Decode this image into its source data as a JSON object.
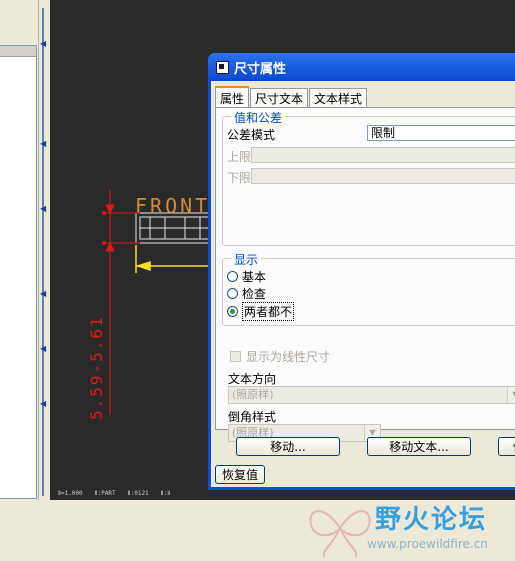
{
  "dialog": {
    "title": "尺寸属性",
    "tabs": [
      {
        "label": "属性",
        "active": true
      },
      {
        "label": "尺寸文本",
        "active": false
      },
      {
        "label": "文本样式",
        "active": false
      }
    ],
    "value_tolerance": {
      "title": "值和公差",
      "tolerance_mode_label": "公差模式",
      "tolerance_mode_value": "限制",
      "upper_label": "上限",
      "lower_label": "下限"
    },
    "display": {
      "title": "显示",
      "options": [
        {
          "label": "基本",
          "checked": false
        },
        {
          "label": "检查",
          "checked": false
        },
        {
          "label": "两者都不",
          "checked": true
        }
      ]
    },
    "linear_checkbox_label": "显示为线性尺寸",
    "text_direction": {
      "label": "文本方向",
      "value": "(照原样)"
    },
    "chamfer_style": {
      "label": "倒角样式",
      "value": "(照原样)"
    },
    "buttons": {
      "move": "移动...",
      "move_text": "移动文本...",
      "modify": "修",
      "restore": "恢复值"
    }
  },
  "canvas": {
    "view_label": "FRONT",
    "dimension_text": "5.59-5.61",
    "status_items": [
      "Ⅱ=1.000",
      "Ⅱ:PART",
      "Ⅱ:0121",
      "Ⅱ:Ⅱ"
    ]
  },
  "watermark": {
    "title": "野火论坛",
    "url": "www.proewildfire.cn"
  },
  "colors": {
    "titlebar": "#0848cf",
    "accent_tab": "#e68b2c",
    "group_title": "#0046d5",
    "dimension_red": "#e01818",
    "view_label_orange": "#d08a3a",
    "leader_yellow": "#f0e020"
  }
}
